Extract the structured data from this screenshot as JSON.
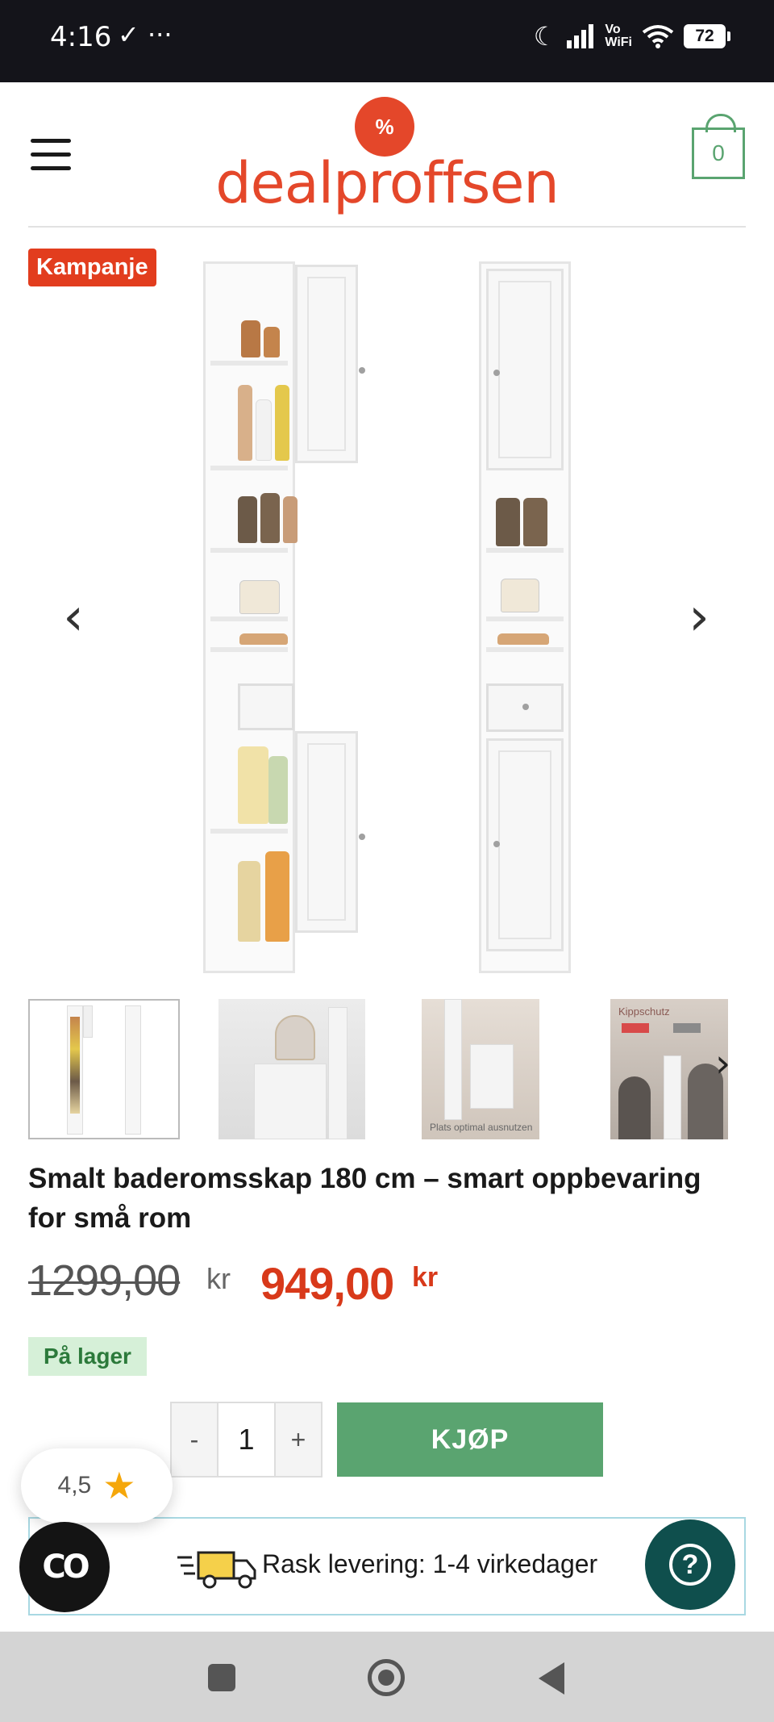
{
  "status_bar": {
    "time": "4:16",
    "left_icons": "✓ ···",
    "volte": "Vo\nWiFi",
    "battery": "72"
  },
  "header": {
    "logo_text": "dealproffsen",
    "logo_badge": "%",
    "cart_count": "0"
  },
  "product": {
    "badge": "Kampanje",
    "title": "Smalt baderomsskap 180 cm – smart oppbevaring for små rom",
    "old_price": "1299,00",
    "old_currency": "kr",
    "new_price": "949,00",
    "new_currency": "kr",
    "stock": "På lager",
    "quantity": "1",
    "minus_label": "-",
    "plus_label": "+",
    "buy_label": "KJØP"
  },
  "thumbnails": {
    "t4_text": "Kippschutz",
    "t3_text": "Plats optimal ausnutzen"
  },
  "delivery": {
    "text": "Rask levering: 1-4 virkedager"
  },
  "rating": {
    "value": "4,5"
  },
  "colors": {
    "brand": "#e4472a",
    "buy": "#5aa470",
    "price": "#d8391a",
    "stock_bg": "#d6f0d8",
    "help": "#0f4f4d"
  }
}
